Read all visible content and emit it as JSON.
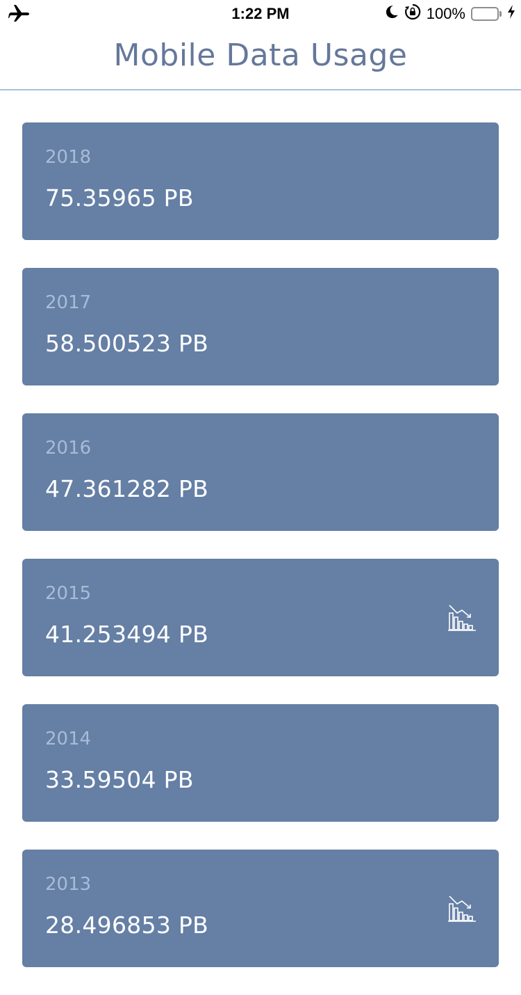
{
  "status_bar": {
    "time": "1:22 PM",
    "battery_percent": "100%",
    "battery_level": 1.0,
    "icons": [
      "airplane-icon",
      "moon-icon",
      "orientation-lock-icon",
      "battery-icon",
      "charging-bolt-icon"
    ]
  },
  "nav": {
    "title": "Mobile Data Usage"
  },
  "colors": {
    "title": "#65789b",
    "divider": "#a9c0dc",
    "card_background": "#657fa5",
    "year_text": "#a8bcd8",
    "value_text": "#ffffff",
    "battery_green": "#72d85f"
  },
  "records": [
    {
      "year": "2018",
      "volume": "75.35965 PB",
      "decrease_icon": false
    },
    {
      "year": "2017",
      "volume": "58.500523 PB",
      "decrease_icon": false
    },
    {
      "year": "2016",
      "volume": "47.361282 PB",
      "decrease_icon": false
    },
    {
      "year": "2015",
      "volume": "41.253494 PB",
      "decrease_icon": true
    },
    {
      "year": "2014",
      "volume": "33.59504 PB",
      "decrease_icon": false
    },
    {
      "year": "2013",
      "volume": "28.496853 PB",
      "decrease_icon": true
    }
  ]
}
